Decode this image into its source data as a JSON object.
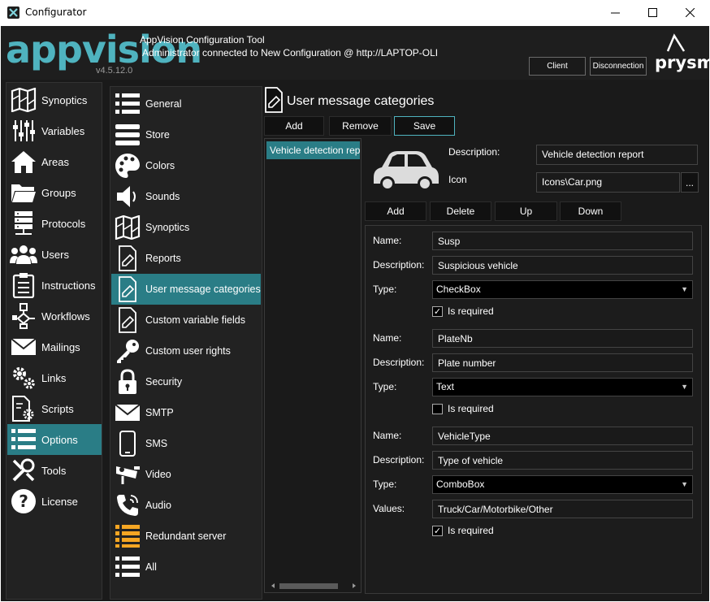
{
  "window": {
    "title": "Configurator"
  },
  "header": {
    "logo": "appvision",
    "version": "v4.5.12.0",
    "tool_title": "AppVision Configuration Tool",
    "connection": "Administrator connected to New Configuration @ http://LAPTOP-OLI",
    "client_btn": "Client",
    "disconnect_btn": "Disconnection",
    "brand": "prysm"
  },
  "leftnav": [
    {
      "label": "Synoptics",
      "icon": "map-icon"
    },
    {
      "label": "Variables",
      "icon": "sliders-icon"
    },
    {
      "label": "Areas",
      "icon": "house-icon"
    },
    {
      "label": "Groups",
      "icon": "folder-icon"
    },
    {
      "label": "Protocols",
      "icon": "server-icon"
    },
    {
      "label": "Users",
      "icon": "users-icon"
    },
    {
      "label": "Instructions",
      "icon": "clipboard-icon"
    },
    {
      "label": "Workflows",
      "icon": "workflow-icon"
    },
    {
      "label": "Mailings",
      "icon": "envelope-icon"
    },
    {
      "label": "Links",
      "icon": "gears-icon"
    },
    {
      "label": "Scripts",
      "icon": "script-icon"
    },
    {
      "label": "Options",
      "icon": "list-icon",
      "active": true
    },
    {
      "label": "Tools",
      "icon": "tools-icon"
    },
    {
      "label": "License",
      "icon": "help-icon"
    }
  ],
  "midnav": [
    {
      "label": "General",
      "icon": "list-icon"
    },
    {
      "label": "Store",
      "icon": "store-icon"
    },
    {
      "label": "Colors",
      "icon": "palette-icon"
    },
    {
      "label": "Sounds",
      "icon": "speaker-icon"
    },
    {
      "label": "Synoptics",
      "icon": "map-icon"
    },
    {
      "label": "Reports",
      "icon": "edit-doc-icon"
    },
    {
      "label": "User message categories",
      "icon": "edit-doc-icon",
      "active": true
    },
    {
      "label": "Custom variable fields",
      "icon": "edit-doc-icon"
    },
    {
      "label": "Custom user rights",
      "icon": "key-icon"
    },
    {
      "label": "Security",
      "icon": "lock-icon"
    },
    {
      "label": "SMTP",
      "icon": "envelope-icon"
    },
    {
      "label": "SMS",
      "icon": "phone-icon"
    },
    {
      "label": "Video",
      "icon": "camera-icon"
    },
    {
      "label": "Audio",
      "icon": "telephone-icon"
    },
    {
      "label": "Redundant server",
      "icon": "redundant-icon"
    },
    {
      "label": "All",
      "icon": "list-icon"
    }
  ],
  "content": {
    "title": "User message categories",
    "add": "Add",
    "remove": "Remove",
    "save": "Save",
    "categories": [
      "Vehicle detection report"
    ],
    "description_label": "Description:",
    "description_value": "Vehicle detection report",
    "icon_label": "Icon",
    "icon_value": "Icons\\Car.png",
    "browse": "...",
    "field_add": "Add",
    "field_delete": "Delete",
    "field_up": "Up",
    "field_down": "Down",
    "labels": {
      "name": "Name:",
      "description": "Description:",
      "type": "Type:",
      "values": "Values:",
      "required": "Is required"
    },
    "fields": [
      {
        "name": "Susp",
        "description": "Suspicious vehicle",
        "type": "CheckBox",
        "required": true
      },
      {
        "name": "PlateNb",
        "description": "Plate number",
        "type": "Text",
        "required": false
      },
      {
        "name": "VehicleType",
        "description": "Type of vehicle",
        "type": "ComboBox",
        "values": "Truck/Car/Motorbike/Other",
        "required": true
      }
    ]
  },
  "colors": {
    "accent": "#2a7d86",
    "logo": "#4fb3bf",
    "background": "#1a1a1a"
  }
}
